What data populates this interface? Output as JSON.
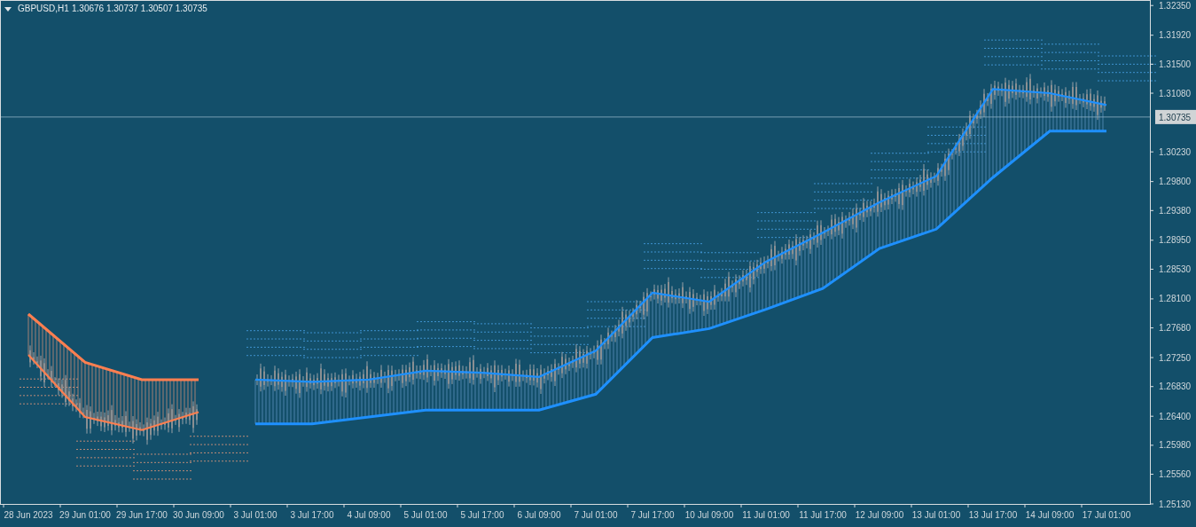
{
  "header": {
    "symbol": "GBPUSD,H1",
    "ohlc": "1.30676 1.30737 1.30507 1.30735"
  },
  "current_price": "1.30735",
  "chart_data": {
    "type": "line",
    "categories": [
      "28 Jun 2023",
      "29 Jun 01:00",
      "29 Jun 17:00",
      "30 Jun 09:00",
      "3 Jul 01:00",
      "3 Jul 17:00",
      "4 Jul 09:00",
      "5 Jul 01:00",
      "5 Jul 17:00",
      "6 Jul 09:00",
      "7 Jul 01:00",
      "7 Jul 17:00",
      "10 Jul 09:00",
      "11 Jul 01:00",
      "11 Jul 17:00",
      "12 Jul 09:00",
      "13 Jul 01:00",
      "13 Jul 17:00",
      "14 Jul 09:00",
      "17 Jul 01:00"
    ],
    "ylim": [
      1.2513,
      1.3243
    ],
    "yticks": [
      {
        "value": 1.3235,
        "label": "1.32350"
      },
      {
        "value": 1.3192,
        "label": "1.31920"
      },
      {
        "value": 1.315,
        "label": "1.31500"
      },
      {
        "value": 1.3108,
        "label": "1.31080"
      },
      {
        "value": 1.3023,
        "label": "1.30230"
      },
      {
        "value": 1.298,
        "label": "1.29800"
      },
      {
        "value": 1.2938,
        "label": "1.29380"
      },
      {
        "value": 1.2895,
        "label": "1.28950"
      },
      {
        "value": 1.2853,
        "label": "1.28530"
      },
      {
        "value": 1.281,
        "label": "1.28100"
      },
      {
        "value": 1.2768,
        "label": "1.27680"
      },
      {
        "value": 1.2725,
        "label": "1.27250"
      },
      {
        "value": 1.2683,
        "label": "1.26830"
      },
      {
        "value": 1.264,
        "label": "1.26400"
      },
      {
        "value": 1.2598,
        "label": "1.25980"
      },
      {
        "value": 1.2556,
        "label": "1.25560"
      },
      {
        "value": 1.2513,
        "label": "1.25130"
      }
    ],
    "series": [
      {
        "color": "#1e90ff",
        "values": [
          null,
          null,
          null,
          null,
          1.2693,
          1.269,
          1.2693,
          1.2706,
          1.2703,
          1.2697,
          1.2735,
          1.2819,
          1.2806,
          1.2864,
          1.2906,
          1.295,
          1.2988,
          1.3114,
          1.3108,
          1.3091
        ]
      },
      {
        "color": "#1e90ff",
        "values": [
          null,
          null,
          null,
          null,
          1.2629,
          1.2629,
          1.2639,
          1.2649,
          1.2649,
          1.2649,
          1.2672,
          1.2754,
          1.2767,
          1.2795,
          1.2825,
          1.2883,
          1.2911,
          1.2986,
          1.3053,
          1.3053
        ]
      },
      {
        "color": "#ff7f50",
        "values": [
          1.2729,
          1.2639,
          1.262,
          1.2646,
          null,
          null,
          null,
          null,
          null,
          null,
          null,
          null,
          null,
          null,
          null,
          null,
          null,
          null,
          null,
          null
        ]
      },
      {
        "color": "#ff7f50",
        "values": [
          1.2788,
          1.2718,
          1.2693,
          1.2693,
          null,
          null,
          null,
          null,
          null,
          null,
          null,
          null,
          null,
          null,
          null,
          null,
          null,
          null,
          null,
          null
        ]
      }
    ]
  }
}
